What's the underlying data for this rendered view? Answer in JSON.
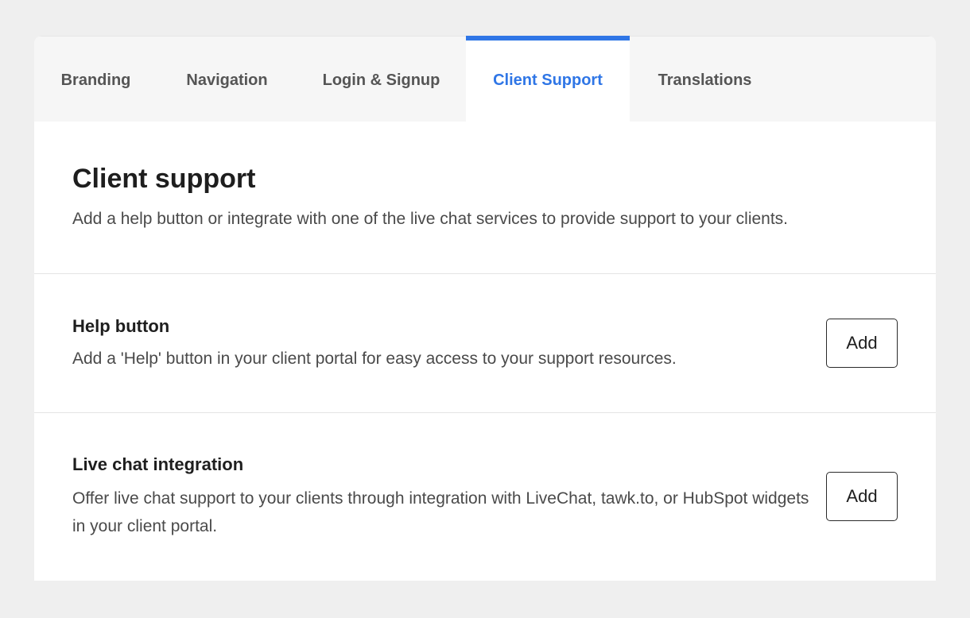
{
  "tabs": [
    {
      "label": "Branding",
      "active": false
    },
    {
      "label": "Navigation",
      "active": false
    },
    {
      "label": "Login & Signup",
      "active": false
    },
    {
      "label": "Client Support",
      "active": true
    },
    {
      "label": "Translations",
      "active": false
    }
  ],
  "header": {
    "title": "Client support",
    "description": "Add a help button or integrate with one of the live chat services to provide support to your clients."
  },
  "sections": {
    "help_button": {
      "title": "Help button",
      "description": "Add a 'Help' button in your client portal for easy access to your support resources.",
      "action_label": "Add"
    },
    "live_chat": {
      "title": "Live chat integration",
      "description": "Offer live chat support to your clients through integration with LiveChat, tawk.to, or HubSpot widgets in your client portal.",
      "action_label": "Add"
    }
  },
  "colors": {
    "accent": "#2f76e6",
    "page_background": "#efefef",
    "tab_bar_background": "#f6f6f6"
  }
}
